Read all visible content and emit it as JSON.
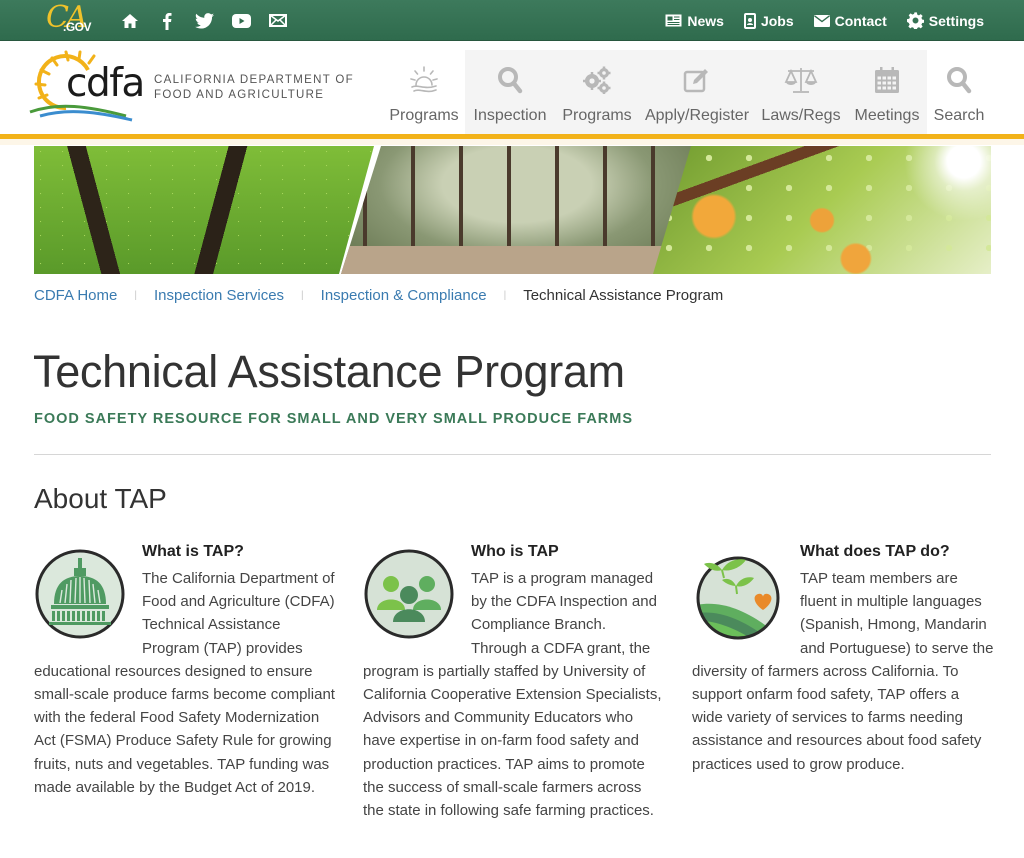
{
  "utility_bar": {
    "logo": {
      "ca": "CA",
      "gov": ".GOV"
    },
    "social_icons": [
      {
        "name": "home-icon"
      },
      {
        "name": "facebook-icon"
      },
      {
        "name": "twitter-icon"
      },
      {
        "name": "youtube-icon"
      },
      {
        "name": "email-icon"
      }
    ],
    "links": [
      {
        "label": "News",
        "icon": "newspaper-icon"
      },
      {
        "label": "Jobs",
        "icon": "badge-icon"
      },
      {
        "label": "Contact",
        "icon": "envelope-icon"
      },
      {
        "label": "Settings",
        "icon": "gear-icon"
      }
    ]
  },
  "branding": {
    "logo_word": "cdfa",
    "dept_line1": "CALIFORNIA DEPARTMENT OF",
    "dept_line2": "FOOD AND AGRICULTURE"
  },
  "main_nav": [
    {
      "label": "Programs",
      "icon": "sun-icon"
    },
    {
      "label": "Inspection",
      "icon": "magnifier-icon"
    },
    {
      "label": "Programs",
      "icon": "gears-icon"
    },
    {
      "label": "Apply/Register",
      "icon": "edit-icon"
    },
    {
      "label": "Laws/Regs",
      "icon": "scales-icon"
    },
    {
      "label": "Meetings",
      "icon": "calendar-icon"
    },
    {
      "label": "Search",
      "icon": "search-icon"
    }
  ],
  "colors": {
    "utility_green": "#2f6b4d",
    "accent_gold": "#f2b219",
    "link_blue": "#3a7bb0",
    "subtitle_green": "#3b7a58"
  },
  "breadcrumb": {
    "items": [
      "CDFA Home",
      "Inspection Services",
      "Inspection & Compliance"
    ],
    "current": "Technical Assistance Program",
    "separator": "|"
  },
  "page": {
    "title": "Technical Assistance Program",
    "subtitle": "FOOD SAFETY RESOURCE FOR SMALL AND VERY SMALL PRODUCE FARMS",
    "section_title": "About TAP"
  },
  "columns": [
    {
      "heading": "What is TAP?",
      "icon": "capitol-dome-icon",
      "body": "The California Department of Food and Agriculture (CDFA) Technical Assistance Program (TAP) provides educational resources designed to ensure small-scale produce farms become compliant with the federal Food Safety Modernization Act (FSMA) Produce Safety Rule for growing fruits, nuts and vegetables. TAP funding was made available by the Budget Act of 2019."
    },
    {
      "heading": "Who is TAP",
      "icon": "people-group-icon",
      "body": "TAP is a program managed by the CDFA Inspection and Compliance Branch. Through a CDFA grant, the program is partially staffed by University of California Cooperative Extension Specialists, Advisors and Community Educators who have expertise in on-farm food safety and production practices. TAP aims to promote the success of small-scale farmers across the state in following safe farming practices."
    },
    {
      "heading": "What does TAP do?",
      "icon": "farm-field-icon",
      "body": "TAP team members are fluent in multiple languages (Spanish, Hmong, Mandarin and Portuguese) to serve the diversity of farmers across California. To support onfarm food safety, TAP offers a wide variety of services to farms needing assistance and resources about food safety practices used to grow produce."
    }
  ]
}
